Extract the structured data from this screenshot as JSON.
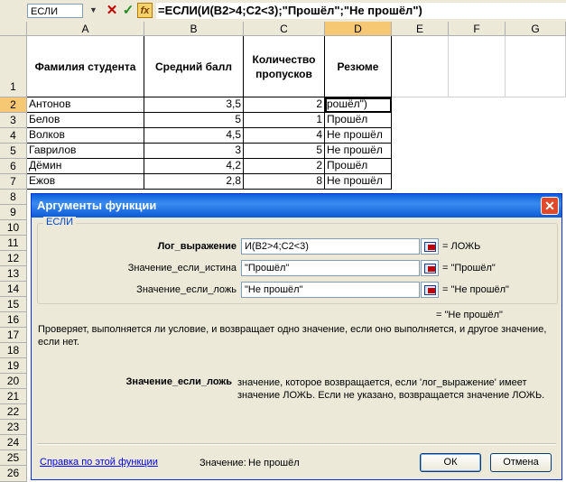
{
  "formula_bar": {
    "name_box": "ЕСЛИ",
    "cancel_symbol": "✕",
    "enter_symbol": "✓",
    "fx_label": "fx",
    "formula": "=ЕСЛИ(И(B2>4;C2<3);\"Прошёл\";\"Не прошёл\")"
  },
  "columns": [
    "A",
    "B",
    "C",
    "D",
    "E",
    "F",
    "G"
  ],
  "rows": [
    "1",
    "2",
    "3",
    "4",
    "5",
    "6",
    "7",
    "8",
    "9",
    "10",
    "11",
    "12",
    "13",
    "14",
    "15",
    "16",
    "17",
    "18",
    "19",
    "20",
    "21",
    "22",
    "23",
    "24",
    "25",
    "26"
  ],
  "header_row": {
    "a": "Фамилия студента",
    "b": "Средний балл",
    "c": "Количество пропусков",
    "d": "Резюме"
  },
  "table": [
    {
      "name": "Антонов",
      "avg": "3,5",
      "absences": "2",
      "summary": "рошёл\")"
    },
    {
      "name": "Белов",
      "avg": "5",
      "absences": "1",
      "summary": "Прошёл"
    },
    {
      "name": "Волков",
      "avg": "4,5",
      "absences": "4",
      "summary": "Не прошёл"
    },
    {
      "name": "Гаврилов",
      "avg": "3",
      "absences": "5",
      "summary": "Не прошёл"
    },
    {
      "name": "Дёмин",
      "avg": "4,2",
      "absences": "2",
      "summary": "Прошёл"
    },
    {
      "name": "Ежов",
      "avg": "2,8",
      "absences": "8",
      "summary": "Не прошёл"
    }
  ],
  "dialog": {
    "title": "Аргументы функции",
    "close": "✕",
    "function_name": "ЕСЛИ",
    "args": [
      {
        "label": "Лог_выражение",
        "value": "И(B2>4;C2<3)",
        "result": "= ЛОЖЬ"
      },
      {
        "label": "Значение_если_истина",
        "value": "\"Прошёл\"",
        "result": "= \"Прошёл\""
      },
      {
        "label": "Значение_если_ложь",
        "value": "\"Не прошёл\"",
        "result": "= \"Не прошёл\""
      }
    ],
    "overall_result": "= \"Не прошёл\"",
    "description": "Проверяет, выполняется ли условие, и возвращает одно значение, если оно выполняется, и другое значение, если нет.",
    "arg_help_name": "Значение_если_ложь",
    "arg_help_text": "значение, которое возвращается, если 'лог_выражение' имеет значение ЛОЖЬ. Если не указано, возвращается значение ЛОЖЬ.",
    "help_link": "Справка по этой функции",
    "value_label": "Значение:",
    "value": "Не прошёл",
    "ok": "ОК",
    "cancel": "Отмена"
  },
  "colors": {
    "selected_header": "#f7c873",
    "title_bar": "#0a5fd8"
  }
}
